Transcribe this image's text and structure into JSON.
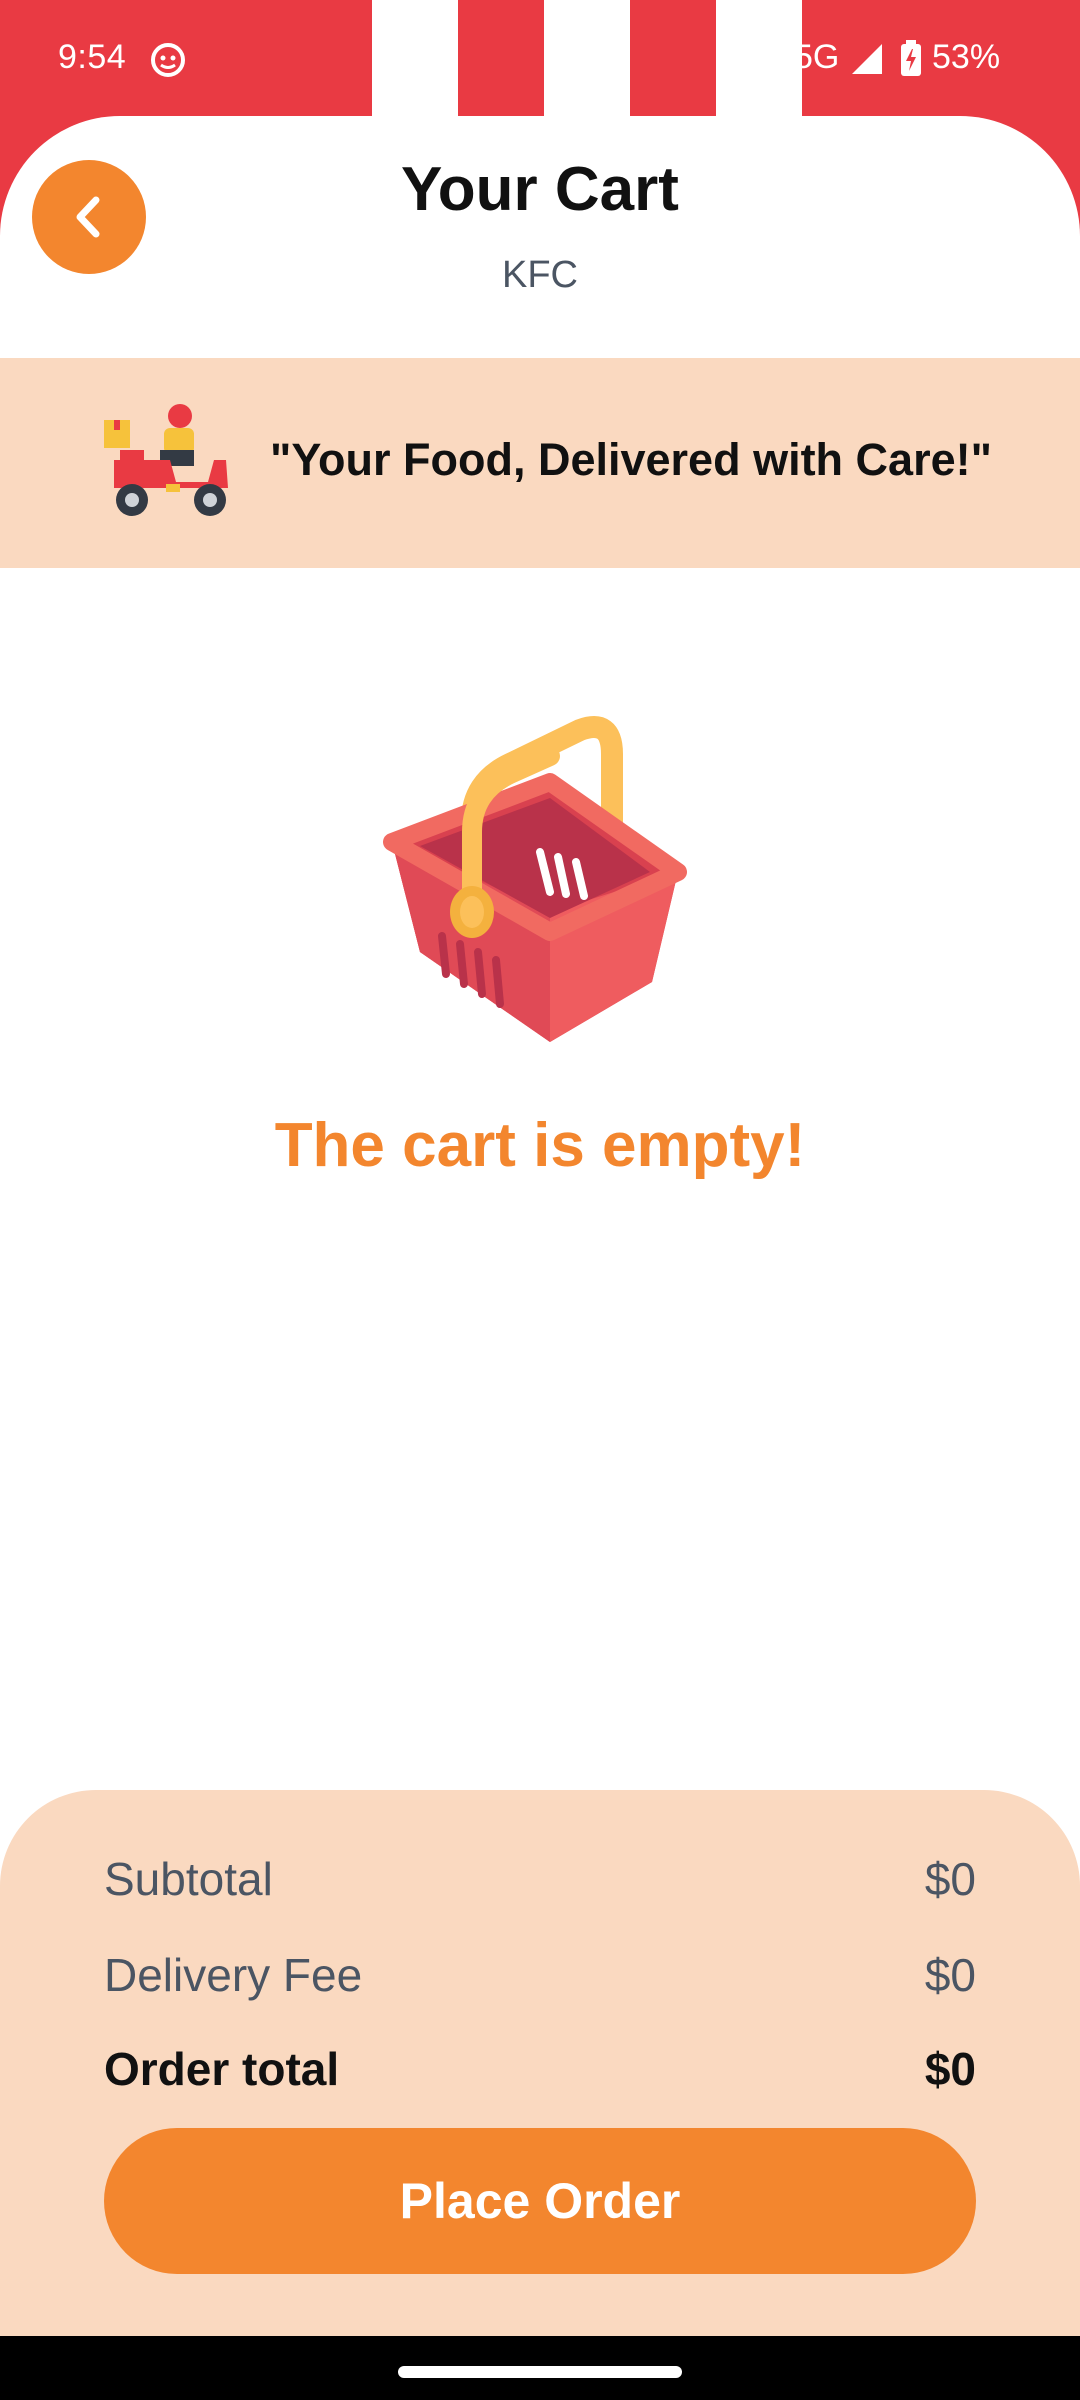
{
  "status_bar": {
    "time": "9:54",
    "network": "5G",
    "battery": "53%"
  },
  "header": {
    "title": "Your Cart",
    "subtitle": "KFC",
    "back_icon": "chevron-left-icon"
  },
  "banner": {
    "text": "\"Your Food, Delivered with Care!\"",
    "icon": "delivery-scooter-icon"
  },
  "empty_state": {
    "message": "The cart is empty!",
    "icon": "shopping-basket-icon"
  },
  "summary": {
    "subtotal_label": "Subtotal",
    "subtotal_value": "$0",
    "delivery_label": "Delivery Fee",
    "delivery_value": "$0",
    "total_label": "Order total",
    "total_value": "$0"
  },
  "actions": {
    "place_order_label": "Place Order"
  },
  "colors": {
    "accent": "#f3862e",
    "brand_red": "#e93a43",
    "banner_bg": "#fad9c0"
  }
}
